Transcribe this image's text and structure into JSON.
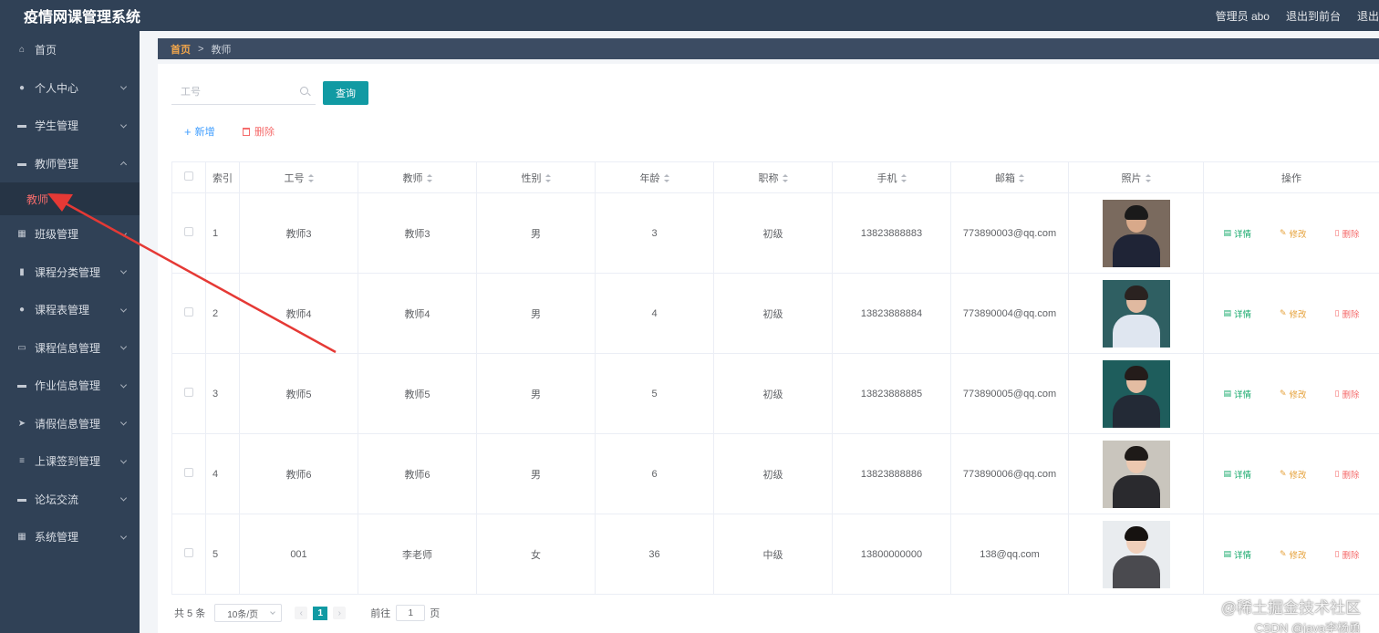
{
  "app": {
    "title": "疫情网课管理系统"
  },
  "header": {
    "user_label": "管理员 abo",
    "back_label": "退出到前台",
    "logout_label": "退出"
  },
  "sidebar": {
    "items": [
      {
        "label": "首页",
        "icon": "home-icon",
        "glyph": "⌂",
        "expandable": false
      },
      {
        "label": "个人中心",
        "icon": "user-icon",
        "glyph": "●",
        "expandable": true
      },
      {
        "label": "学生管理",
        "icon": "briefcase-icon",
        "glyph": "▬",
        "expandable": true
      },
      {
        "label": "教师管理",
        "icon": "chat-icon",
        "glyph": "▬",
        "expandable": true,
        "expanded": true
      },
      {
        "label": "班级管理",
        "icon": "grid-icon",
        "glyph": "▦",
        "expandable": true
      },
      {
        "label": "课程分类管理",
        "icon": "clipboard-icon",
        "glyph": "▮",
        "expandable": true
      },
      {
        "label": "课程表管理",
        "icon": "pin-icon",
        "glyph": "●",
        "expandable": true
      },
      {
        "label": "课程信息管理",
        "icon": "card-icon",
        "glyph": "▭",
        "expandable": true
      },
      {
        "label": "作业信息管理",
        "icon": "ticket-icon",
        "glyph": "▬",
        "expandable": true
      },
      {
        "label": "请假信息管理",
        "icon": "send-icon",
        "glyph": "➤",
        "expandable": true
      },
      {
        "label": "上课签到管理",
        "icon": "sliders-icon",
        "glyph": "≡",
        "expandable": true
      },
      {
        "label": "论坛交流",
        "icon": "message-icon",
        "glyph": "▬",
        "expandable": true
      },
      {
        "label": "系统管理",
        "icon": "apps-icon",
        "glyph": "▦",
        "expandable": true
      }
    ],
    "submenu": {
      "label": "教师"
    }
  },
  "breadcrumb": {
    "home": "首页",
    "separator": ">",
    "current": "教师"
  },
  "search": {
    "placeholder": "工号",
    "value": "",
    "button_label": "查询"
  },
  "toolbar": {
    "add_label": "新增",
    "delete_label": "删除"
  },
  "table": {
    "headers": [
      "索引",
      "工号",
      "教师",
      "性别",
      "年龄",
      "职称",
      "手机",
      "邮箱",
      "照片",
      "操作"
    ],
    "op_labels": {
      "detail": "详情",
      "edit": "修改",
      "remove": "删除"
    },
    "rows": [
      {
        "index": "1",
        "id": "教师3",
        "name": "教师3",
        "gender": "男",
        "age": "3",
        "title": "初级",
        "phone": "13823888883",
        "email": "773890003@qq.com",
        "photo": {
          "bg": "#7a6a5e",
          "skin": "#d8a98a",
          "hair": "#1a1a1a",
          "cloth": "#1f2436"
        }
      },
      {
        "index": "2",
        "id": "教师4",
        "name": "教师4",
        "gender": "男",
        "age": "4",
        "title": "初级",
        "phone": "13823888884",
        "email": "773890004@qq.com",
        "photo": {
          "bg": "#2f5f62",
          "skin": "#e0b9a0",
          "hair": "#2a2220",
          "cloth": "#dfe6f0"
        }
      },
      {
        "index": "3",
        "id": "教师5",
        "name": "教师5",
        "gender": "男",
        "age": "5",
        "title": "初级",
        "phone": "13823888885",
        "email": "773890005@qq.com",
        "photo": {
          "bg": "#1e5d5c",
          "skin": "#e3bca2",
          "hair": "#241c1a",
          "cloth": "#232a36"
        }
      },
      {
        "index": "4",
        "id": "教师6",
        "name": "教师6",
        "gender": "男",
        "age": "6",
        "title": "初级",
        "phone": "13823888886",
        "email": "773890006@qq.com",
        "photo": {
          "bg": "#c9c5bd",
          "skin": "#ecc8b0",
          "hair": "#1e1a18",
          "cloth": "#2a2a2e"
        }
      },
      {
        "index": "5",
        "id": "001",
        "name": "李老师",
        "gender": "女",
        "age": "36",
        "title": "中级",
        "phone": "13800000000",
        "email": "138@qq.com",
        "photo": {
          "bg": "#e9ecef",
          "skin": "#f0cfba",
          "hair": "#161210",
          "cloth": "#4a4a4f"
        }
      }
    ]
  },
  "pagination": {
    "total_label": "共 5 条",
    "page_size": "10条/页",
    "current_page": "1",
    "goto_label": "前往",
    "goto_value": "1",
    "page_suffix": "页"
  },
  "watermark": {
    "line1": "@稀土掘金技术社区",
    "line2": "CSDN @java李杨勇"
  },
  "colors": {
    "sidebar_bg": "#304156",
    "accent": "#119aa3",
    "danger": "#f56c6c",
    "primary": "#409eff",
    "success": "#13a86a",
    "warning": "#e6a23c",
    "annotation_arrow": "#e53935"
  }
}
